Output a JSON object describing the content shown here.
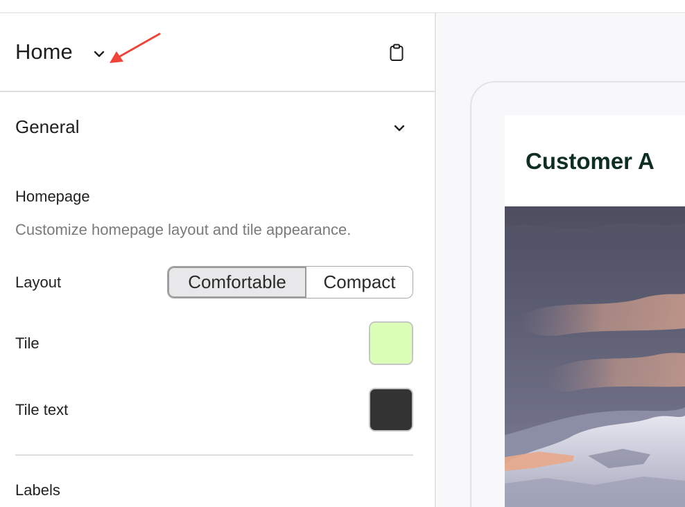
{
  "header": {
    "title": "Home"
  },
  "section": {
    "title": "General",
    "subsection_title": "Homepage",
    "description": "Customize homepage layout and tile appearance.",
    "layout_label": "Layout",
    "layout_options": [
      "Comfortable",
      "Compact"
    ],
    "layout_selected": "Comfortable",
    "tile_label": "Tile",
    "tile_color": "#dcffb8",
    "tile_text_label": "Tile text",
    "tile_text_color": "#333333",
    "next_section_label": "Labels"
  },
  "preview": {
    "brand_name": "Customer A"
  },
  "colors": {
    "annotation_arrow": "#f04438",
    "brand_text": "#0f2e22"
  },
  "icons": {
    "title_chevron": "chevron-down-icon",
    "clipboard": "clipboard-icon",
    "section_chevron": "chevron-down-icon"
  }
}
